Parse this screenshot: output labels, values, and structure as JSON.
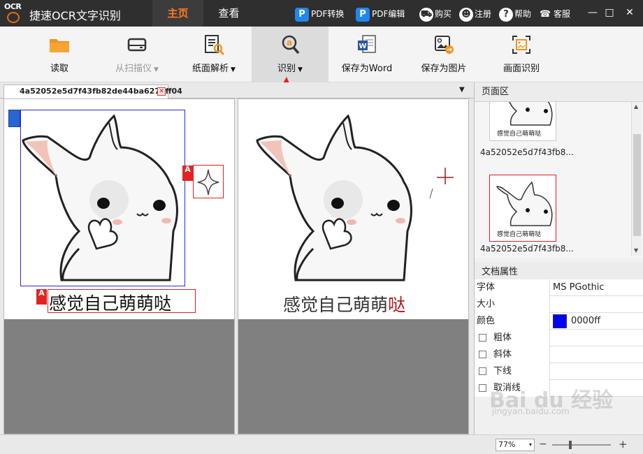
{
  "app": {
    "logo_text": "OCR",
    "title": "捷速OCR文字识别"
  },
  "nav_tabs": [
    {
      "label": "主页",
      "active": true
    },
    {
      "label": "查看",
      "active": false
    }
  ],
  "top_links": {
    "pdf_convert": {
      "badge": "P",
      "label": "PDF转换"
    },
    "pdf_edit": {
      "badge": "P",
      "label": "PDF编辑"
    },
    "buy": "购买",
    "register": "注册",
    "help": "帮助",
    "support": "客服"
  },
  "window_controls": {
    "minimize": "—",
    "maximize": "□",
    "close": "✕"
  },
  "toolbar": {
    "read": "读取",
    "scan": "从扫描仪",
    "paper_parse": "纸面解析",
    "recognize": "识别",
    "save_word": "保存为Word",
    "save_image": "保存为图片",
    "screen_recognize": "画面识别",
    "caret": "▼"
  },
  "doc_tab": {
    "name": "4a52052e5d7f43fb82de44ba6270ff04",
    "close": "✕",
    "dropdown": "▼"
  },
  "left_pane": {
    "ocr_text": "感觉自己萌萌哒",
    "mark": "A"
  },
  "right_pane": {
    "ocr_text_main": "感觉自己萌萌",
    "ocr_text_last": "哒"
  },
  "panel": {
    "pages_title": "页面区",
    "thumbs": [
      {
        "caption": "4a52052e5d7f43fb8...",
        "thumb_text": "感觉自己萌萌哒",
        "selected": false
      },
      {
        "caption": "4a52052e5d7f43fb8...",
        "thumb_text": "感觉自己萌萌哒",
        "selected": true
      }
    ],
    "props_title": "文档属性",
    "props": {
      "font_label": "字体",
      "font_value": "MS PGothic",
      "size_label": "大小",
      "size_value": "",
      "color_label": "颜色",
      "color_value": "0000ff",
      "bold_label": "粗体",
      "italic_label": "斜体",
      "underline_label": "下线",
      "strike_label": "取消线"
    }
  },
  "status": {
    "zoom": "77%",
    "minus": "−",
    "plus": "+",
    "zoom_dropdown": "▾"
  },
  "watermark": {
    "text": "Bai du 经验",
    "sub": "jingyan.baidu.com"
  },
  "colors": {
    "accent": "#ff7a1a",
    "highlight": "#d22222",
    "ocr_box": "#2b2bd0",
    "font_color": "#0000ff"
  }
}
